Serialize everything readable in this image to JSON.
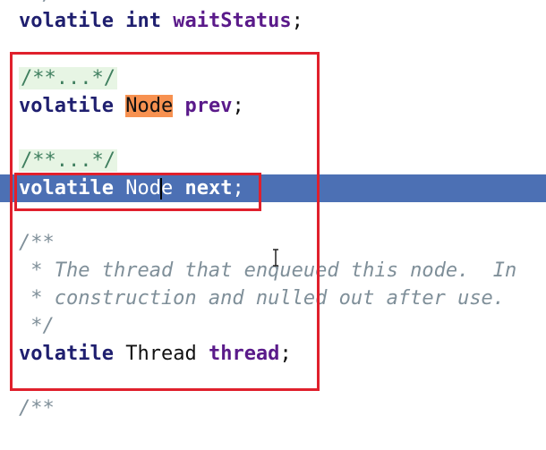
{
  "editor": {
    "line0": {
      "kw": "volatile",
      "type": "int",
      "field": "waitStatus",
      "punct": ";"
    },
    "fold1": "/**...*/",
    "line_prev": {
      "kw": "volatile",
      "type": "Node",
      "field": "prev",
      "punct": ";"
    },
    "fold2": "/**...*/",
    "line_next": {
      "kw": "volatile",
      "type_a": "Nod",
      "type_b": "e",
      "field": "next",
      "punct": ";"
    },
    "doc_open": "/**",
    "doc_line1": " * The thread that enqueued this node.  In",
    "doc_line2": " * construction and nulled out after use.",
    "doc_close": " */",
    "line_thread": {
      "kw": "volatile",
      "type": "Thread",
      "field": "thread",
      "punct": ";"
    },
    "doc_open2": "/**"
  },
  "colors": {
    "highlight_box": "#e0202c",
    "selection": "#4c70b4",
    "occurrence_highlight": "#f79150"
  }
}
